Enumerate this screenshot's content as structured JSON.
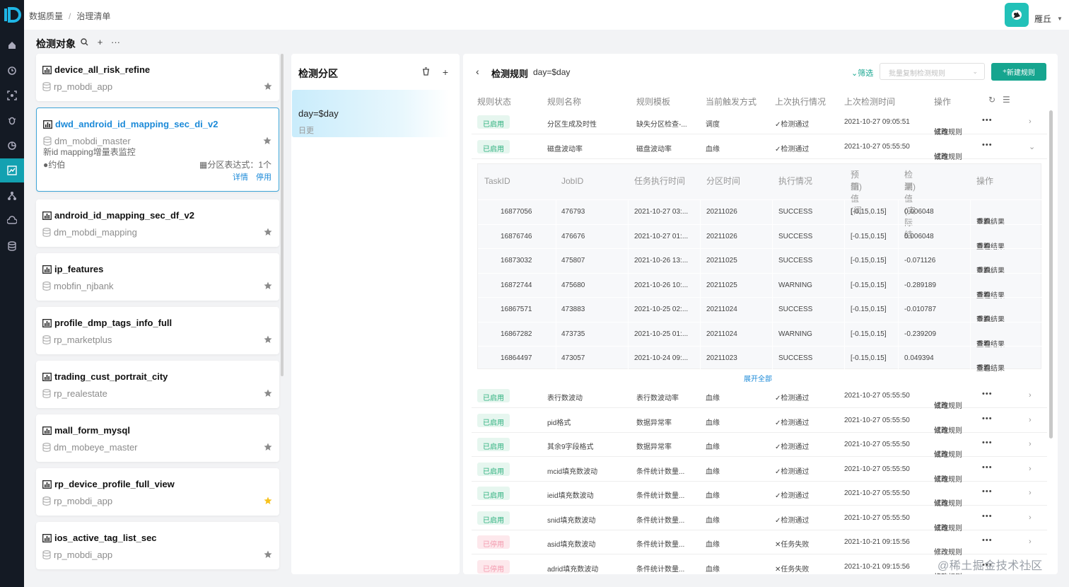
{
  "breadcrumb": {
    "parent": "数据质量",
    "current": "治理清单"
  },
  "user": {
    "name": "雁丘"
  },
  "objects": {
    "title": "检测对象",
    "items": [
      {
        "name": "device_all_risk_refine",
        "db": "rp_mobdi_app",
        "starred": false
      },
      {
        "name": "dwd_android_id_mapping_sec_di_v2",
        "db": "dm_mobdi_master",
        "starred": false,
        "selected": true,
        "desc": "新id mapping增量表监控",
        "owner": "约伯",
        "partition": "分区表达式：1个",
        "detail": "详情",
        "disable": "停用"
      },
      {
        "name": "android_id_mapping_sec_df_v2",
        "db": "dm_mobdi_mapping",
        "starred": false
      },
      {
        "name": "ip_features",
        "db": "mobfin_njbank",
        "starred": false
      },
      {
        "name": "profile_dmp_tags_info_full",
        "db": "rp_marketplus",
        "starred": false
      },
      {
        "name": "trading_cust_portrait_city",
        "db": "rp_realestate",
        "starred": false
      },
      {
        "name": "mall_form_mysql",
        "db": "dm_mobeye_master",
        "starred": false
      },
      {
        "name": "rp_device_profile_full_view",
        "db": "rp_mobdi_app",
        "starred": true
      },
      {
        "name": "ios_active_tag_list_sec",
        "db": "rp_mobdi_app",
        "starred": false
      }
    ]
  },
  "partitions": {
    "title": "检测分区",
    "items": [
      {
        "name": "day=$day",
        "freq": "日更"
      }
    ]
  },
  "rules": {
    "title": "检测规则",
    "subtitle": "day=$day",
    "filter": "筛选",
    "copy_placeholder": "批量复制检测规则",
    "new_button": "新建规则",
    "columns": [
      "规则状态",
      "规则名称",
      "规则模板",
      "当前触发方式",
      "上次执行情况",
      "上次检测时间",
      "操作"
    ],
    "action_run": "试跑",
    "action_edit": "修改规则",
    "rows": [
      {
        "status": "已启用",
        "name": "分区生成及时性",
        "template": "缺失分区检查-...",
        "trigger": "调度",
        "result": "✓检测通过",
        "time": "2021-10-27 09:05:51",
        "enabled": true
      },
      {
        "status": "已启用",
        "name": "磁盘波动率",
        "template": "磁盘波动率",
        "trigger": "血缘",
        "result": "✓检测通过",
        "time": "2021-10-27 05:55:50",
        "enabled": true,
        "expanded": true
      },
      {
        "status": "已启用",
        "name": "表行数波动",
        "template": "表行数波动率",
        "trigger": "血缘",
        "result": "✓检测通过",
        "time": "2021-10-27 05:55:50",
        "enabled": true
      },
      {
        "status": "已启用",
        "name": "pid格式",
        "template": "数据异常率",
        "trigger": "血缘",
        "result": "✓检测通过",
        "time": "2021-10-27 05:55:50",
        "enabled": true
      },
      {
        "status": "已启用",
        "name": "其余9字段格式",
        "template": "数据异常率",
        "trigger": "血缘",
        "result": "✓检测通过",
        "time": "2021-10-27 05:55:50",
        "enabled": true
      },
      {
        "status": "已启用",
        "name": "mcid填充数波动",
        "template": "条件统计数量...",
        "trigger": "血缘",
        "result": "✓检测通过",
        "time": "2021-10-27 05:55:50",
        "enabled": true
      },
      {
        "status": "已启用",
        "name": "ieid填充数波动",
        "template": "条件统计数量...",
        "trigger": "血缘",
        "result": "✓检测通过",
        "time": "2021-10-27 05:55:50",
        "enabled": true
      },
      {
        "status": "已启用",
        "name": "snid填充数波动",
        "template": "条件统计数量...",
        "trigger": "血缘",
        "result": "✓检测通过",
        "time": "2021-10-27 05:55:50",
        "enabled": true
      },
      {
        "status": "已停用",
        "name": "asid填充数波动",
        "template": "条件统计数量...",
        "trigger": "血缘",
        "result": "✕任务失败",
        "time": "2021-10-21 09:15:56",
        "enabled": false
      },
      {
        "status": "已停用",
        "name": "adrid填充数波动",
        "template": "条件统计数量...",
        "trigger": "血缘",
        "result": "✕任务失败",
        "time": "2021-10-21 09:15:56",
        "enabled": false
      }
    ],
    "tasks": {
      "columns": [
        "TaskID",
        "JobID",
        "任务执行时间",
        "分区时间",
        "执行情况",
        "预期值(阈值)",
        "检测值(实际结果)",
        "操作"
      ],
      "col5_line1": "预期值(阈",
      "col5_line2": "值)",
      "col6_line1": "检测值(实际结",
      "col6_line2": "果)",
      "rerun": "重跑",
      "view": "查看结果",
      "rows": [
        {
          "task": "16877056",
          "job": "476793",
          "exec": "2021-10-27 03:...",
          "part": "20211026",
          "state": "SUCCESS",
          "expect": "[-0.15,0.15]",
          "value": "0.006048"
        },
        {
          "task": "16876746",
          "job": "476676",
          "exec": "2021-10-27 01:...",
          "part": "20211026",
          "state": "SUCCESS",
          "expect": "[-0.15,0.15]",
          "value": "0.006048"
        },
        {
          "task": "16873032",
          "job": "475807",
          "exec": "2021-10-26 13:...",
          "part": "20211025",
          "state": "SUCCESS",
          "expect": "[-0.15,0.15]",
          "value": "-0.071126"
        },
        {
          "task": "16872744",
          "job": "475680",
          "exec": "2021-10-26 10:...",
          "part": "20211025",
          "state": "WARNING",
          "expect": "[-0.15,0.15]",
          "value": "-0.289189"
        },
        {
          "task": "16867571",
          "job": "473883",
          "exec": "2021-10-25 02:...",
          "part": "20211024",
          "state": "SUCCESS",
          "expect": "[-0.15,0.15]",
          "value": "-0.010787"
        },
        {
          "task": "16867282",
          "job": "473735",
          "exec": "2021-10-25 01:...",
          "part": "20211024",
          "state": "WARNING",
          "expect": "[-0.15,0.15]",
          "value": "-0.239209"
        },
        {
          "task": "16864497",
          "job": "473057",
          "exec": "2021-10-24 09:...",
          "part": "20211023",
          "state": "SUCCESS",
          "expect": "[-0.15,0.15]",
          "value": "0.049394"
        }
      ],
      "expand_all": "展开全部"
    }
  },
  "watermark": "@稀土掘金技术社区",
  "colors": {
    "accent": "#16a58f",
    "link": "#1c8ad8",
    "nav_active": "#13a1b1",
    "nav_bg": "#141a24"
  }
}
